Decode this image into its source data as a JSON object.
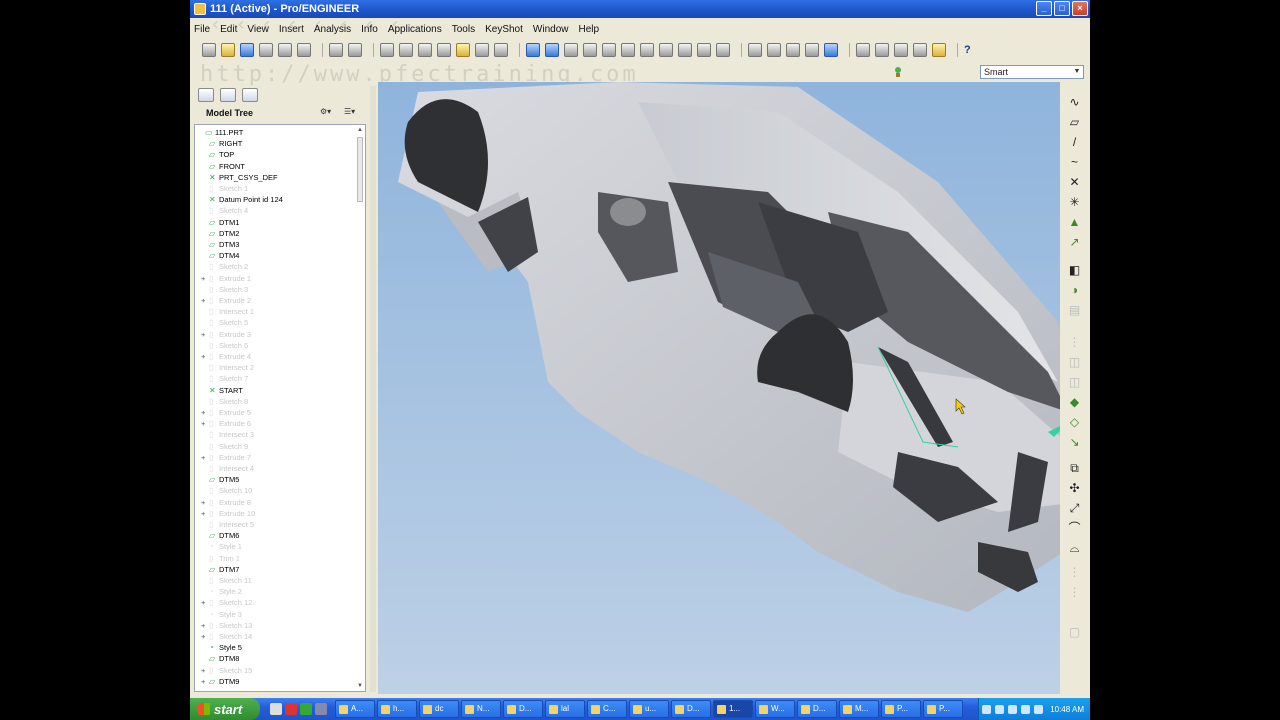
{
  "window": {
    "title": "111 (Active) - Pro/ENGINEER"
  },
  "watermark": {
    "line1": "‹ ‹ ‹ ‹ ‹ ‹ ‹ ‹",
    "line2": "http://www.pfectraining.com"
  },
  "menu": [
    "File",
    "Edit",
    "View",
    "Insert",
    "Analysis",
    "Info",
    "Applications",
    "Tools",
    "KeyShot",
    "Window",
    "Help"
  ],
  "filter": {
    "value": "Smart"
  },
  "model_tree": {
    "label": "Model Tree",
    "items": [
      {
        "label": "111.PRT",
        "icon": "part-icon",
        "dim": false,
        "exp": ""
      },
      {
        "label": "RIGHT",
        "icon": "datum-plane-icon",
        "dim": false,
        "exp": ""
      },
      {
        "label": "TOP",
        "icon": "datum-plane-icon",
        "dim": false,
        "exp": ""
      },
      {
        "label": "FRONT",
        "icon": "datum-plane-icon",
        "dim": false,
        "exp": ""
      },
      {
        "label": "PRT_CSYS_DEF",
        "icon": "csys-icon",
        "dim": false,
        "exp": ""
      },
      {
        "label": "Sketch 1",
        "icon": "sketch-icon",
        "dim": true,
        "exp": ""
      },
      {
        "label": "Datum Point id 124",
        "icon": "datum-point-icon",
        "dim": false,
        "exp": ""
      },
      {
        "label": "Sketch 4",
        "icon": "sketch-icon",
        "dim": true,
        "exp": ""
      },
      {
        "label": "DTM1",
        "icon": "datum-plane-icon",
        "dim": false,
        "exp": ""
      },
      {
        "label": "DTM2",
        "icon": "datum-plane-icon",
        "dim": false,
        "exp": ""
      },
      {
        "label": "DTM3",
        "icon": "datum-plane-icon",
        "dim": false,
        "exp": ""
      },
      {
        "label": "DTM4",
        "icon": "datum-plane-icon",
        "dim": false,
        "exp": ""
      },
      {
        "label": "Sketch 2",
        "icon": "sketch-icon",
        "dim": true,
        "exp": ""
      },
      {
        "label": "Extrude 1",
        "icon": "extrude-icon",
        "dim": true,
        "exp": "+"
      },
      {
        "label": "Sketch 3",
        "icon": "sketch-icon",
        "dim": true,
        "exp": ""
      },
      {
        "label": "Extrude 2",
        "icon": "extrude-icon",
        "dim": true,
        "exp": "+"
      },
      {
        "label": "Intersect 1",
        "icon": "intersect-icon",
        "dim": true,
        "exp": ""
      },
      {
        "label": "Sketch 5",
        "icon": "sketch-icon",
        "dim": true,
        "exp": ""
      },
      {
        "label": "Extrude 3",
        "icon": "extrude-icon",
        "dim": true,
        "exp": "+"
      },
      {
        "label": "Sketch 6",
        "icon": "sketch-icon",
        "dim": true,
        "exp": ""
      },
      {
        "label": "Extrude 4",
        "icon": "extrude-icon",
        "dim": true,
        "exp": "+"
      },
      {
        "label": "Intersect 2",
        "icon": "intersect-icon",
        "dim": true,
        "exp": ""
      },
      {
        "label": "Sketch 7",
        "icon": "sketch-icon",
        "dim": true,
        "exp": ""
      },
      {
        "label": "START",
        "icon": "datum-point-icon",
        "dim": false,
        "exp": ""
      },
      {
        "label": "Sketch 8",
        "icon": "sketch-icon",
        "dim": true,
        "exp": ""
      },
      {
        "label": "Extrude 5",
        "icon": "extrude-icon",
        "dim": true,
        "exp": "+"
      },
      {
        "label": "Extrude 6",
        "icon": "extrude-icon",
        "dim": true,
        "exp": "+"
      },
      {
        "label": "Intersect 3",
        "icon": "intersect-icon",
        "dim": true,
        "exp": ""
      },
      {
        "label": "Sketch 9",
        "icon": "sketch-icon",
        "dim": true,
        "exp": ""
      },
      {
        "label": "Extrude 7",
        "icon": "extrude-icon",
        "dim": true,
        "exp": "+"
      },
      {
        "label": "Intersect 4",
        "icon": "intersect-icon",
        "dim": true,
        "exp": ""
      },
      {
        "label": "DTM5",
        "icon": "datum-plane-icon",
        "dim": false,
        "exp": ""
      },
      {
        "label": "Sketch 10",
        "icon": "sketch-icon",
        "dim": true,
        "exp": ""
      },
      {
        "label": "Extrude 8",
        "icon": "extrude-icon",
        "dim": true,
        "exp": "+"
      },
      {
        "label": "Extrude 10",
        "icon": "extrude-icon",
        "dim": true,
        "exp": "+"
      },
      {
        "label": "Intersect 5",
        "icon": "intersect-icon",
        "dim": true,
        "exp": ""
      },
      {
        "label": "DTM6",
        "icon": "datum-plane-icon",
        "dim": false,
        "exp": ""
      },
      {
        "label": "Style 1",
        "icon": "style-icon",
        "dim": true,
        "exp": ""
      },
      {
        "label": "Trim 1",
        "icon": "trim-icon",
        "dim": true,
        "exp": ""
      },
      {
        "label": "DTM7",
        "icon": "datum-plane-icon",
        "dim": false,
        "exp": ""
      },
      {
        "label": "Sketch 11",
        "icon": "sketch-icon",
        "dim": true,
        "exp": ""
      },
      {
        "label": "Style 2",
        "icon": "style-icon",
        "dim": true,
        "exp": ""
      },
      {
        "label": "Sketch 12",
        "icon": "sketch-icon",
        "dim": true,
        "exp": "+"
      },
      {
        "label": "Style 3",
        "icon": "style-icon",
        "dim": true,
        "exp": ""
      },
      {
        "label": "Sketch 13",
        "icon": "sketch-icon",
        "dim": true,
        "exp": "+"
      },
      {
        "label": "Sketch 14",
        "icon": "sketch-icon",
        "dim": true,
        "exp": "+"
      },
      {
        "label": "Style 5",
        "icon": "style-icon",
        "dim": false,
        "exp": ""
      },
      {
        "label": "DTM8",
        "icon": "datum-plane-icon",
        "dim": false,
        "exp": ""
      },
      {
        "label": "Sketch 15",
        "icon": "sketch-icon",
        "dim": true,
        "exp": "+"
      },
      {
        "label": "DTM9",
        "icon": "datum-plane-icon",
        "dim": false,
        "exp": "+"
      }
    ]
  },
  "taskbar": {
    "start_label": "start",
    "tasks": [
      {
        "label": "A..."
      },
      {
        "label": "h..."
      },
      {
        "label": "dc"
      },
      {
        "label": "N..."
      },
      {
        "label": "D..."
      },
      {
        "label": "lal"
      },
      {
        "label": "C..."
      },
      {
        "label": "u..."
      },
      {
        "label": "D..."
      },
      {
        "label": "1..."
      },
      {
        "label": "W..."
      },
      {
        "label": "D..."
      },
      {
        "label": "M..."
      },
      {
        "label": "P..."
      },
      {
        "label": "P..."
      }
    ],
    "clock": "10:48 AM"
  }
}
